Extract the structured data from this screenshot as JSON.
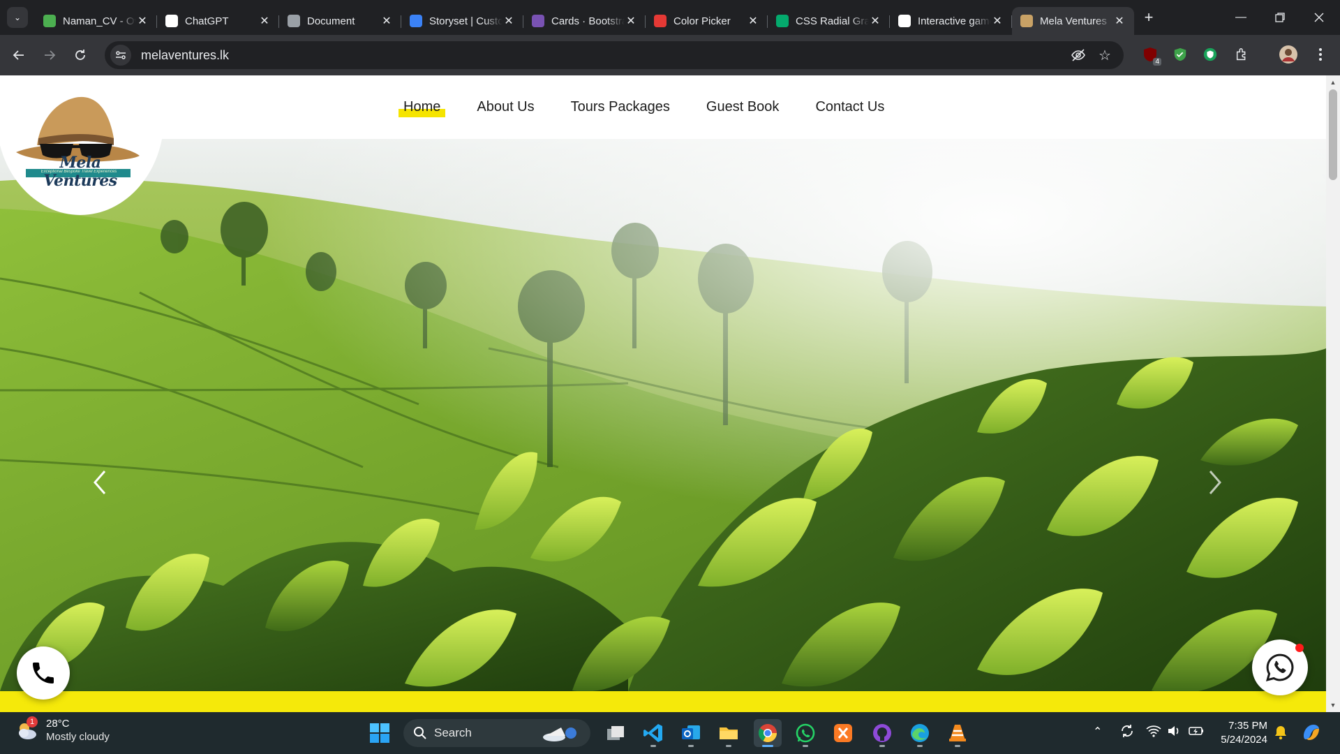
{
  "browser": {
    "tabs": [
      {
        "title": "Naman_CV - Overleaf",
        "favicon": "overleaf-icon",
        "color": "#4caf50"
      },
      {
        "title": "ChatGPT",
        "favicon": "chatgpt-icon",
        "color": "#ffffff"
      },
      {
        "title": "Document",
        "favicon": "globe-icon",
        "color": "#9aa0a6"
      },
      {
        "title": "Storyset | Customize",
        "favicon": "storyset-icon",
        "color": "#3b82f6"
      },
      {
        "title": "Cards · Bootstrap",
        "favicon": "bootstrap-icon",
        "color": "#7952b3"
      },
      {
        "title": "Color Picker",
        "favicon": "color-picker-icon",
        "color": "#e53935"
      },
      {
        "title": "CSS Radial Gradient",
        "favicon": "w3schools-icon",
        "color": "#04aa6d"
      },
      {
        "title": "Interactive games",
        "favicon": "ai-icon",
        "color": "#ffffff"
      },
      {
        "title": "Mela Ventures",
        "favicon": "mela-favicon",
        "color": "#c9a266"
      }
    ],
    "active_tab_index": 8,
    "url": "melaventures.lk",
    "extension_badge": "4"
  },
  "site": {
    "logo": {
      "name": "Mela Ventures",
      "tagline": "Exceptional Bespoke Travel Experiences"
    },
    "nav": [
      {
        "label": "Home",
        "active": true
      },
      {
        "label": "About Us",
        "active": false
      },
      {
        "label": "Tours Packages",
        "active": false
      },
      {
        "label": "Guest Book",
        "active": false
      },
      {
        "label": "Contact Us",
        "active": false
      }
    ],
    "colors": {
      "accent_yellow": "#f5e90a",
      "text": "#1b1b1b",
      "whatsapp": "#25d366"
    }
  },
  "taskbar": {
    "weather": {
      "temp": "28°C",
      "condition": "Mostly cloudy",
      "badge": "1"
    },
    "search_label": "Search",
    "time": "7:35 PM",
    "date": "5/24/2024"
  }
}
